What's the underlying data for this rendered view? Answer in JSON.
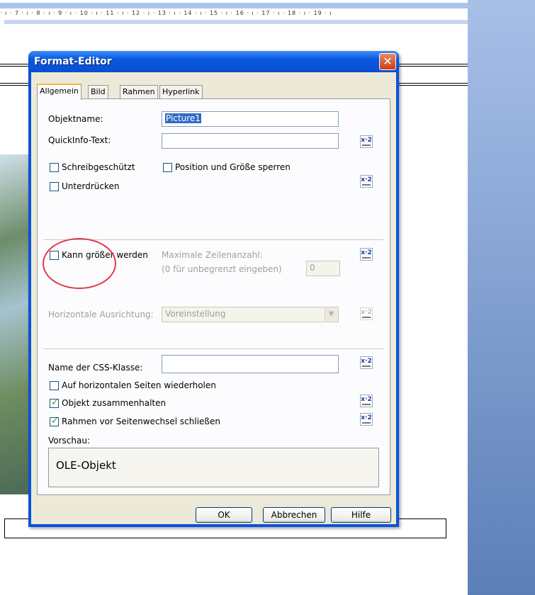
{
  "ruler": {
    "ticks": "· ı · 7 · ı · 8 · ı · 9 · ı · 10 · ı · 11 · ı · 12 · ı · 13 · ı · 14 · ı · 15 · ı · 16 · ı · 17 · ı · 18 · ı · 19 · ı"
  },
  "dialog": {
    "title": "Format-Editor",
    "close_label": "✕",
    "tabs": [
      "Allgemein",
      "Bild",
      "Rahmen",
      "Hyperlink"
    ],
    "general": {
      "objektname_label": "Objektname:",
      "objektname_value": "Picture1",
      "quickinfo_label": "QuickInfo-Text:",
      "quickinfo_value": "",
      "schreibgeschuetzt": {
        "label": "Schreibgeschützt",
        "checked": false
      },
      "position_sperren": {
        "label": "Position und Größe sperren",
        "checked": false
      },
      "unterdruecken": {
        "label": "Unterdrücken",
        "checked": false
      },
      "kann_groesser": {
        "label": "Kann größer werden",
        "checked": false
      },
      "max_zeilen_label": "Maximale Zeilenanzahl:",
      "max_zeilen_hint": "(0 für unbegrenzt eingeben)",
      "max_zeilen_value": "0",
      "h_ausrichtung_label": "Horizontale Ausrichtung:",
      "h_ausrichtung_value": "Voreinstellung",
      "css_label": "Name der CSS-Klasse:",
      "css_value": "",
      "wiederholen": {
        "label": "Auf horizontalen Seiten wiederholen",
        "checked": false
      },
      "zusammenhalten": {
        "label": "Objekt zusammenhalten",
        "checked": true
      },
      "rahmen_schliessen": {
        "label": "Rahmen vor Seitenwechsel schließen",
        "checked": true
      },
      "vorschau_label": "Vorschau:",
      "vorschau_text": "OLE-Objekt"
    },
    "formula_label": "x·2",
    "buttons": {
      "ok": "OK",
      "abbrechen": "Abbrechen",
      "hilfe": "Hilfe"
    }
  }
}
